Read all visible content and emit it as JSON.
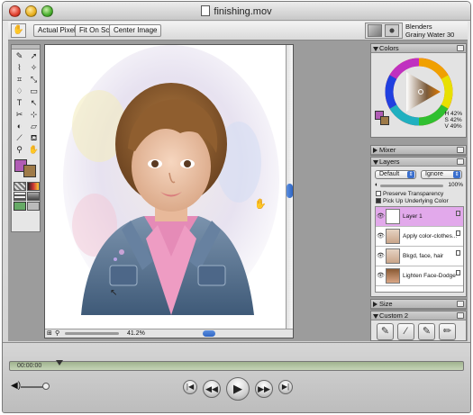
{
  "window": {
    "title": "finishing.mov"
  },
  "property_bar": {
    "actual_pixels": "Actual Pixels",
    "fit_on_screen": "Fit On Screen",
    "center_image": "Center Image",
    "brush_category": "Blenders",
    "brush_variant": "Grainy Water 30"
  },
  "document": {
    "zoom": "41.2%"
  },
  "colors_palette": {
    "title": "Colors",
    "h": "H 42%",
    "s": "S 42%",
    "v": "V 49%",
    "main_color": "#b05cb5",
    "secondary_color": "#9e7a48"
  },
  "mixer_palette": {
    "title": "Mixer"
  },
  "layers_palette": {
    "title": "Layers",
    "composite_method": "Default",
    "ignore": "Ignore",
    "opacity": "100%",
    "preserve_transparency": "Preserve Transparency",
    "pick_up_underlying": "Pick Up Underlying Color",
    "layers": [
      {
        "name": "Layer 1",
        "selected": true
      },
      {
        "name": "Apply color-clothes..."
      },
      {
        "name": "Bkgd, face, hair"
      },
      {
        "name": "Lighten Face-Dodge"
      }
    ]
  },
  "size_palette": {
    "title": "Size"
  },
  "custom_palette": {
    "title": "Custom 2"
  },
  "player": {
    "timecode": "00:00:00"
  }
}
